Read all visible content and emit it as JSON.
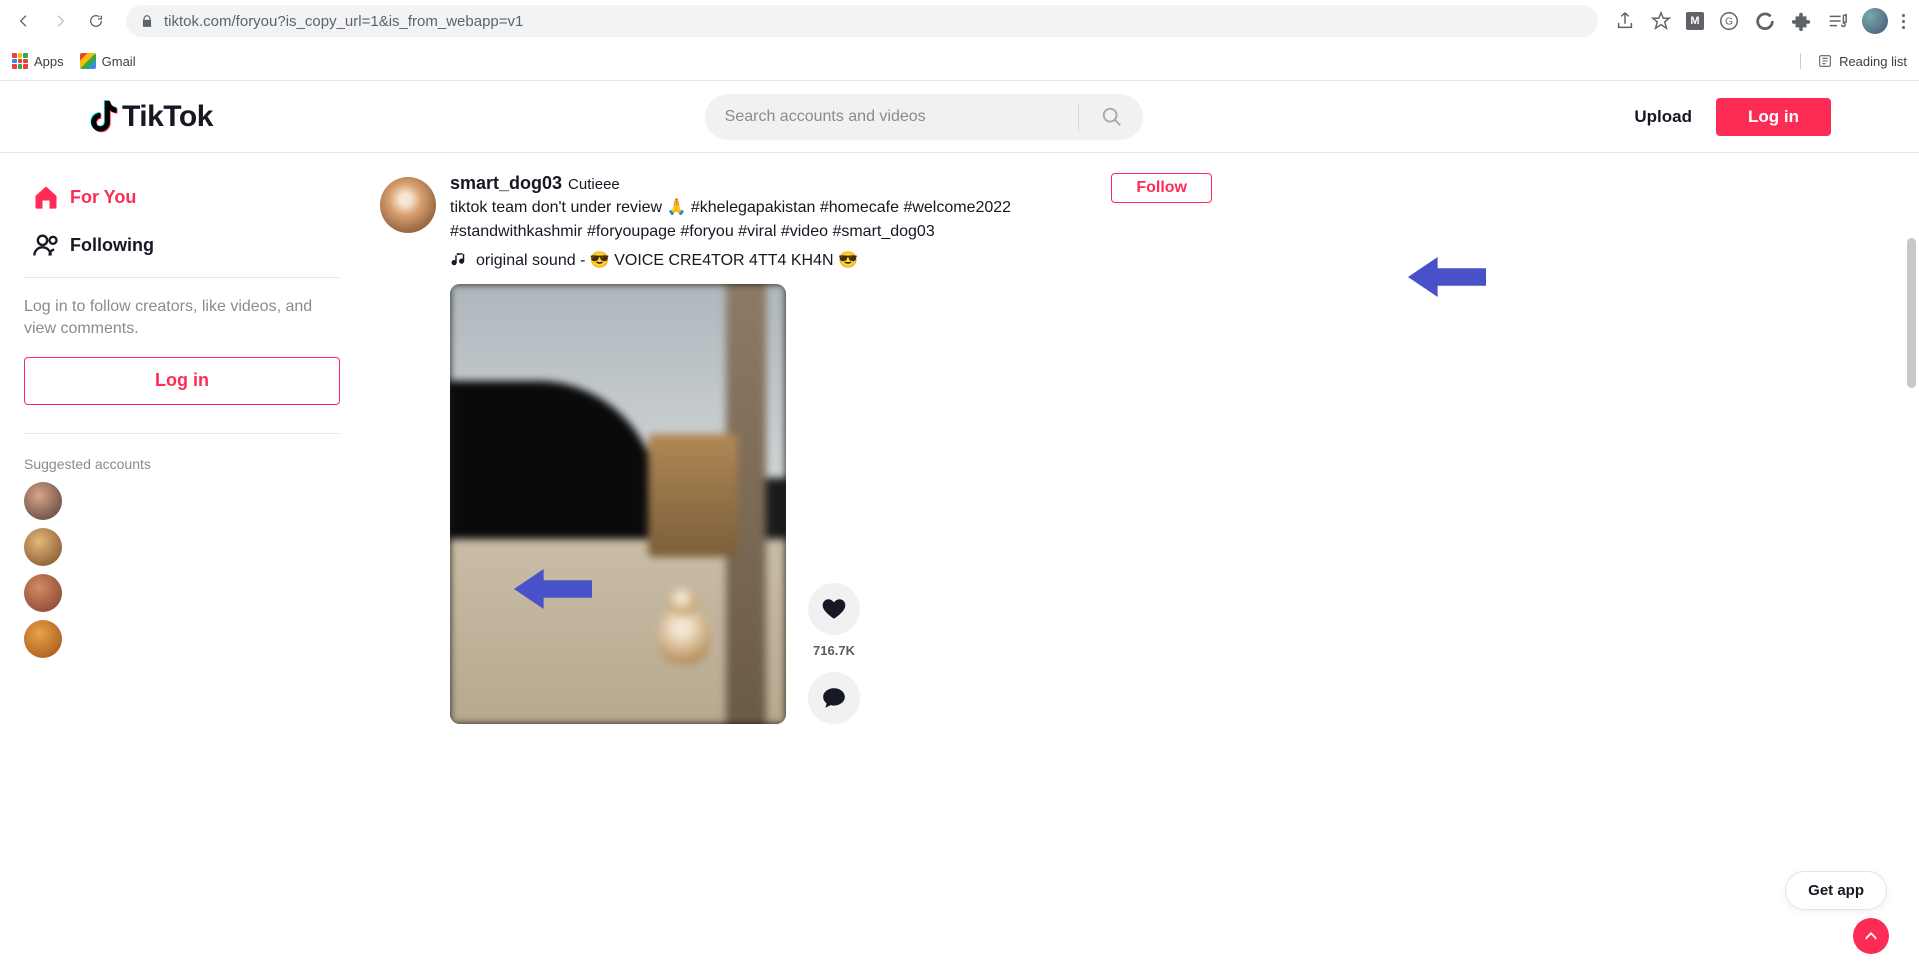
{
  "browser": {
    "url": "tiktok.com/foryou?is_copy_url=1&is_from_webapp=v1",
    "bookmarks": {
      "apps": "Apps",
      "gmail": "Gmail",
      "reading": "Reading list"
    }
  },
  "header": {
    "logo_text": "TikTok",
    "search_placeholder": "Search accounts and videos",
    "upload": "Upload",
    "login": "Log in"
  },
  "sidebar": {
    "for_you": "For You",
    "following": "Following",
    "login_prompt": "Log in to follow creators, like videos, and view comments.",
    "login_btn": "Log in",
    "suggested_title": "Suggested accounts"
  },
  "feed": {
    "username": "smart_dog03",
    "nickname": "Cutieee",
    "caption": "tiktok team don't under review 🙏 #khelegapakistan #homecafe #welcome2022 #standwithkashmir #foryoupage #foryou #viral #video #smart_dog03",
    "sound": "original sound - 😎 VOICE CRE4TOR 4TT4 KH4N 😎",
    "follow": "Follow",
    "like_count": "716.7K"
  },
  "floating": {
    "get_app": "Get app"
  }
}
